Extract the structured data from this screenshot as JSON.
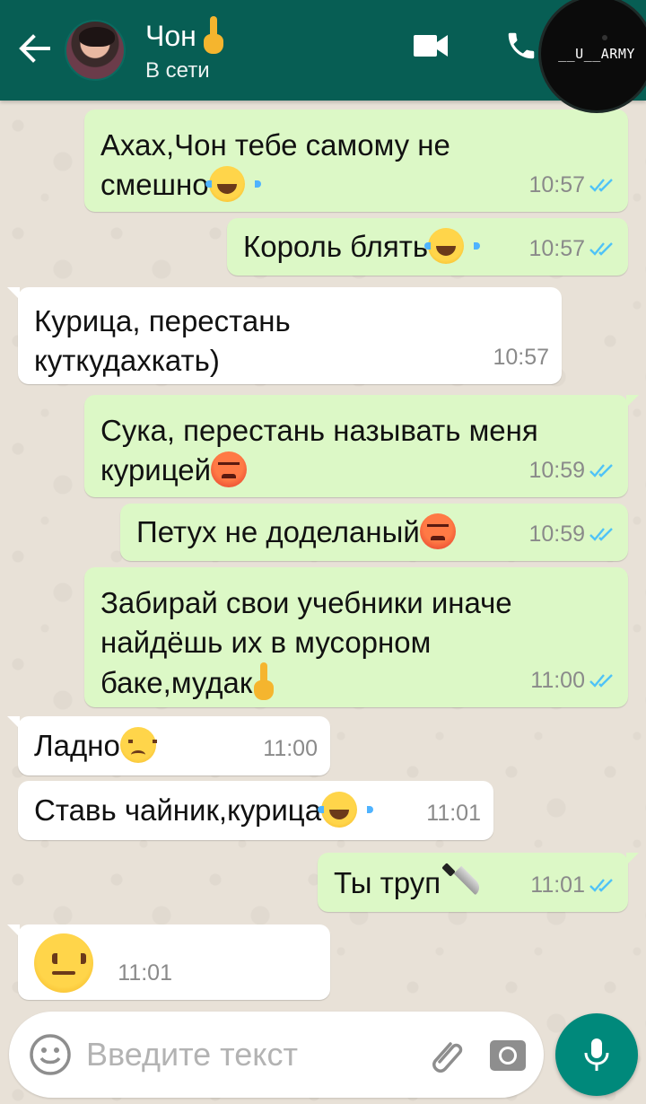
{
  "header": {
    "contact_name": "Чон",
    "status": "В сети",
    "watermark": "__U__ARMY",
    "back_icon": "arrow-left-icon",
    "video_icon": "video-camera-icon",
    "call_icon": "phone-icon"
  },
  "colors": {
    "header": "#075e54",
    "outgoing_bubble": "#dcf8c6",
    "incoming_bubble": "#ffffff",
    "read_ticks": "#4fc3f7",
    "mic_button": "#00897b"
  },
  "messages": [
    {
      "direction": "out",
      "text": "Ахах,Чон тебе самому не\nсмешно",
      "emoji": "laughing-tears",
      "time": "10:57",
      "read": true
    },
    {
      "direction": "out",
      "text": "Король блять",
      "emoji": "laughing-tears",
      "time": "10:57",
      "read": true
    },
    {
      "direction": "in",
      "text": "Курица, перестань\nкуткудахкать)",
      "time": "10:57"
    },
    {
      "direction": "out",
      "text": "Сука, перестань называть меня\nкурицей",
      "emoji": "angry-face",
      "time": "10:59",
      "read": true
    },
    {
      "direction": "out",
      "text": "Петух не доделаный",
      "emoji": "angry-face",
      "time": "10:59",
      "read": true
    },
    {
      "direction": "out",
      "text": "Забирай свои учебники иначе\nнайдёшь их в мусорном\nбаке,мудак",
      "emoji": "middle-finger",
      "time": "11:00",
      "read": true
    },
    {
      "direction": "in",
      "text": "Ладно",
      "emoji": "disappointed-face",
      "time": "11:00"
    },
    {
      "direction": "in",
      "text": "Ставь чайник,курица",
      "emoji": "laughing-tears",
      "time": "11:01"
    },
    {
      "direction": "out",
      "text": "Ты труп",
      "emoji": "knife",
      "time": "11:01",
      "read": true
    },
    {
      "direction": "in",
      "text": "",
      "emoji": "neutral-face",
      "time": "11:01"
    }
  ],
  "composer": {
    "placeholder": "Введите текст",
    "emoji_icon": "smiley-icon",
    "attach_icon": "paperclip-icon",
    "camera_icon": "camera-icon",
    "mic_icon": "microphone-icon"
  }
}
